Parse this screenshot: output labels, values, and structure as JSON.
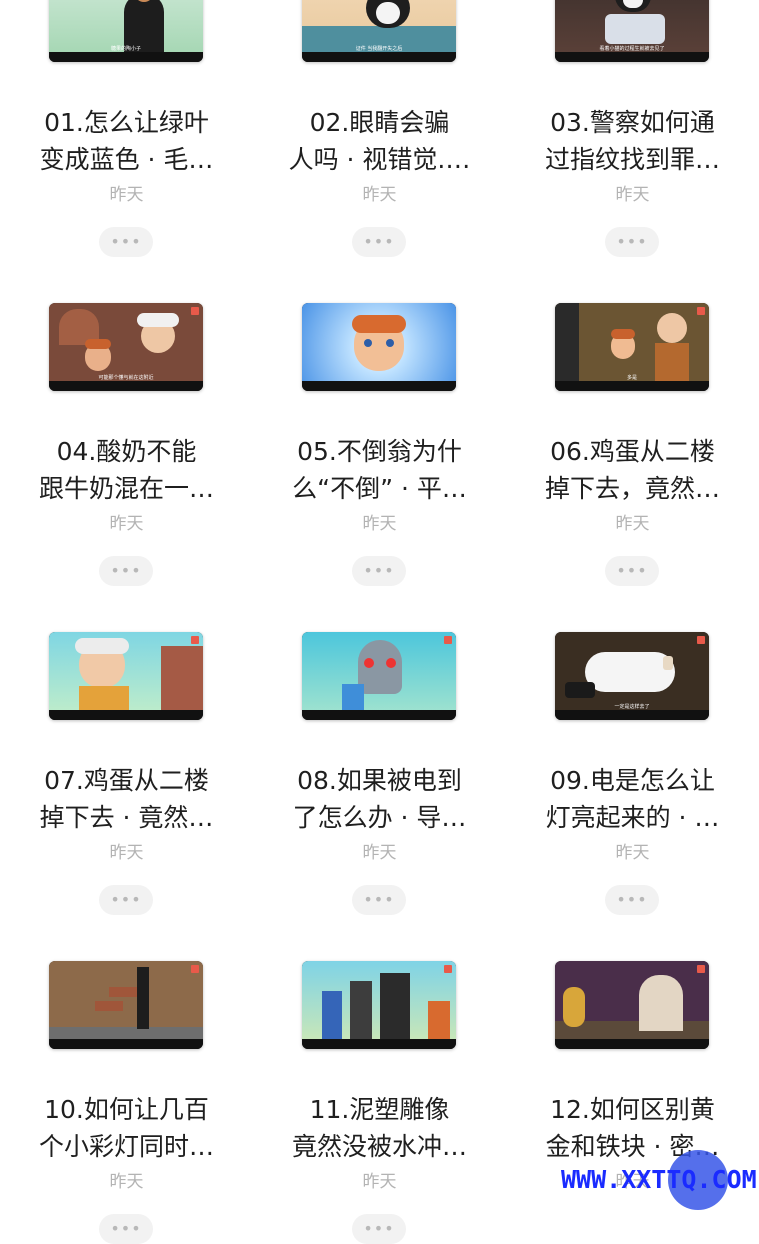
{
  "videos": [
    {
      "title_line1": "01.怎么让绿叶",
      "title_line2": "变成蓝色 · 毛…",
      "date": "昨天",
      "subtitle": "糖果的陶小子",
      "more": "•••"
    },
    {
      "title_line1": "02.眼睛会骗",
      "title_line2": "人吗 · 视错觉.…",
      "date": "昨天",
      "subtitle": "证件 当我翻开失之后",
      "more": "•••"
    },
    {
      "title_line1": "03.警察如何通",
      "title_line2": "过指纹找到罪…",
      "date": "昨天",
      "subtitle": "看着小猫的过程生就被去见了",
      "more": "•••"
    },
    {
      "title_line1": "04.酸奶不能",
      "title_line2": "跟牛奶混在一…",
      "date": "昨天",
      "subtitle": "可能那个懂与就在这附近",
      "more": "•••"
    },
    {
      "title_line1": "05.不倒翁为什",
      "title_line2": "么“不倒” · 平…",
      "date": "昨天",
      "subtitle": "",
      "more": "•••"
    },
    {
      "title_line1": "06.鸡蛋从二楼",
      "title_line2": "掉下去，竟然…",
      "date": "昨天",
      "subtitle": "多是",
      "more": "•••"
    },
    {
      "title_line1": "07.鸡蛋从二楼",
      "title_line2": "掉下去 · 竟然…",
      "date": "昨天",
      "subtitle": "",
      "more": "•••"
    },
    {
      "title_line1": "08.如果被电到",
      "title_line2": "了怎么办 · 导…",
      "date": "昨天",
      "subtitle": "",
      "more": "•••"
    },
    {
      "title_line1": "09.电是怎么让",
      "title_line2": "灯亮起来的 · …",
      "date": "昨天",
      "subtitle": "一定是这样去了",
      "more": "•••"
    },
    {
      "title_line1": "10.如何让几百",
      "title_line2": "个小彩灯同时…",
      "date": "昨天",
      "subtitle": "",
      "more": "•••"
    },
    {
      "title_line1": "11.泥塑雕像",
      "title_line2": "竟然没被水冲…",
      "date": "昨天",
      "subtitle": "",
      "more": "•••"
    },
    {
      "title_line1": "12.如何区别黄",
      "title_line2": "金和铁块 · 密…",
      "date": "昨天",
      "subtitle": "",
      "more": "•••"
    }
  ],
  "watermark": "WWW.XXTTQ.COM",
  "colors": {
    "title": "#1f1f1f",
    "date": "#b3b3b3",
    "more_bg": "#f2f2f2",
    "watermark": "#1a2bff"
  }
}
